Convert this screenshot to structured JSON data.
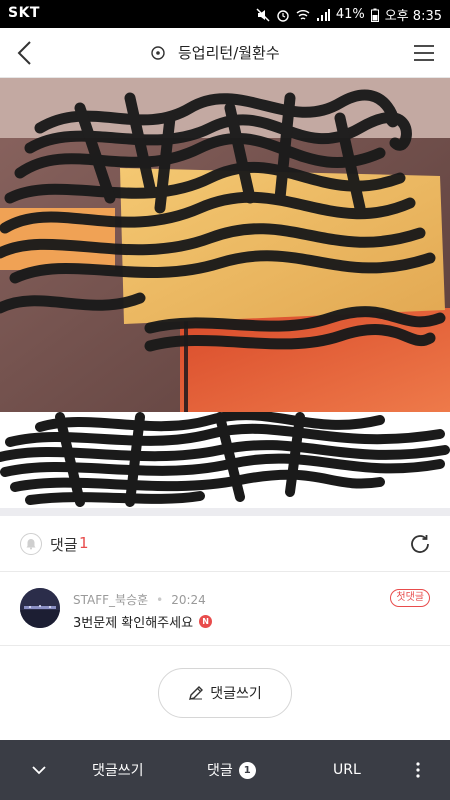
{
  "status_bar": {
    "carrier": "SKT",
    "battery": "41%",
    "time": "오후 8:35"
  },
  "header": {
    "title": "등업리턴/월환수",
    "back_icon": "chevron-left-icon",
    "menu_icon": "hamburger-menu-icon",
    "target_icon": "target-icon"
  },
  "comments": {
    "label": "댓글",
    "count": "1",
    "items": [
      {
        "author": "STAFF_북승훈",
        "time": "20:24",
        "text": "3번문제 확인해주세요",
        "new_badge": "N",
        "reply_label": "첫댓글"
      }
    ]
  },
  "write_button": {
    "label": "댓글쓰기"
  },
  "bottom_bar": {
    "write_label": "댓글쓰기",
    "comments_label": "댓글",
    "comments_count": "1",
    "url_label": "URL"
  },
  "colors": {
    "accent": "#e84c4c",
    "bottom_bar_bg": "#3a3d45",
    "divider": "#ececf0"
  }
}
